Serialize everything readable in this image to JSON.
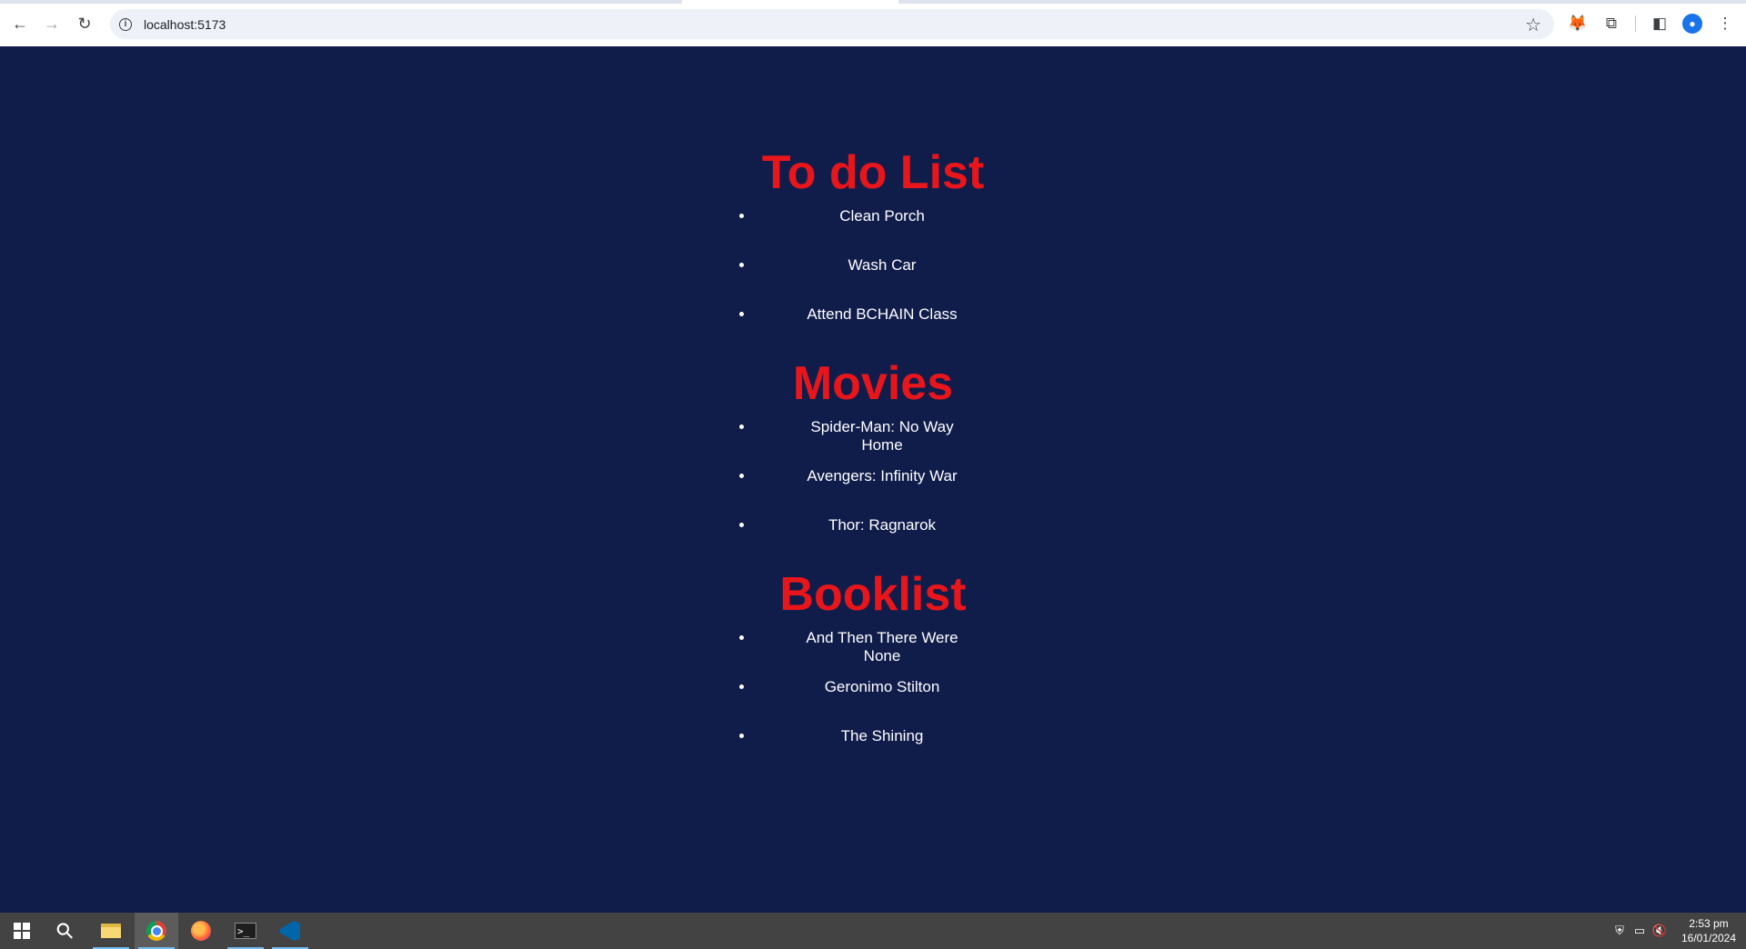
{
  "browser": {
    "url": "localhost:5173",
    "back_icon": "←",
    "forward_icon": "→",
    "reload_icon": "↻",
    "info_icon": "i",
    "star_icon": "☆",
    "extension_icon": "⧉",
    "sidepanel_icon": "◧",
    "menu_icon": "⋮",
    "profile_icon": "●",
    "fox_icon": "🦊"
  },
  "sections": [
    {
      "title": "To do List",
      "items": [
        "Clean Porch",
        "Wash Car",
        "Attend BCHAIN Class"
      ]
    },
    {
      "title": "Movies",
      "items": [
        "Spider-Man: No Way Home",
        "Avengers: Infinity War",
        "Thor: Ragnarok"
      ]
    },
    {
      "title": "Booklist",
      "items": [
        "And Then There Were None",
        "Geronimo Stilton",
        "The Shining"
      ]
    }
  ],
  "colors": {
    "page_background": "#101d4b",
    "heading": "#e8161b",
    "item_text": "#ffffff"
  },
  "taskbar": {
    "search_icon": "⚲",
    "terminal_label": ">_",
    "tray_security_icon": "⛨",
    "tray_network_icon": "▭",
    "tray_volume_icon": "🔇",
    "time": "2:53 pm",
    "date": "16/01/2024"
  }
}
